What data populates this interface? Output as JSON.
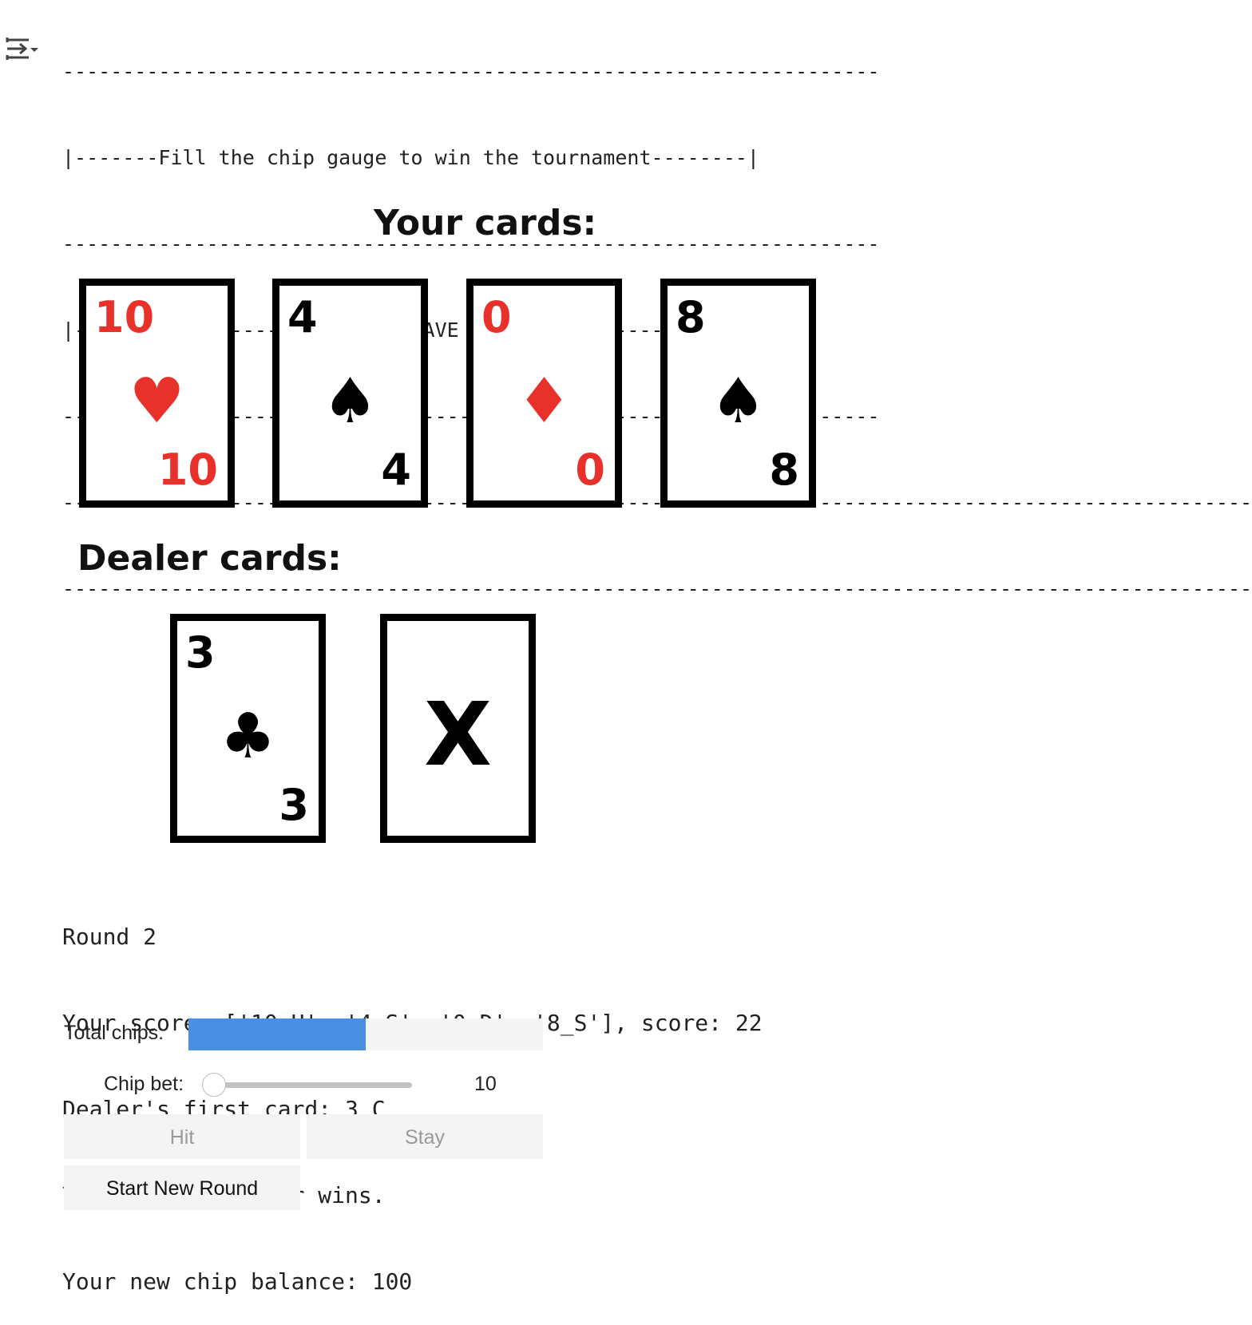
{
  "output_toggle": {
    "icon": "output-toggle-icon"
  },
  "banner": {
    "lines": [
      "--------------------------------------------------------------------",
      "|-------Fill the chip gauge to win the tournament--------|",
      "--------------------------------------------------------------------",
      "|-----------------GOOD LUCK. HAVE FUN------------------|",
      "--------------------------------------------------------------------",
      "----------------------------------------------------------------------------------------------------",
      "----------------------------------------------------------------------------------------------------"
    ]
  },
  "player": {
    "heading": "Your cards:",
    "cards": [
      {
        "rank": "10",
        "suit": "♥",
        "suit_name": "hearts",
        "color": "#e8312a"
      },
      {
        "rank": "4",
        "suit": "♠",
        "suit_name": "spades",
        "color": "#000000"
      },
      {
        "rank": "0",
        "suit": "♦",
        "suit_name": "diamonds",
        "color": "#e8312a"
      },
      {
        "rank": "8",
        "suit": "♠",
        "suit_name": "spades",
        "color": "#000000"
      }
    ]
  },
  "dealer": {
    "heading": "Dealer cards:",
    "cards": [
      {
        "rank": "3",
        "suit": "♣",
        "suit_name": "clubs",
        "color": "#000000"
      }
    ],
    "hidden_card": "X"
  },
  "log": {
    "round": "Round 2",
    "score": "Your score: ['10_H', '4_S', '0_D', '8_S'], score: 22",
    "dealer_first": "Dealer's first card: 3_C",
    "result": "You busted! Dealer wins.",
    "balance": "Your new chip balance: 100"
  },
  "gauge": {
    "label": "Total chips:",
    "fill_fraction": 0.5,
    "color": "#4a90e2"
  },
  "bet": {
    "label": "Chip bet:",
    "value": "10",
    "slider_fraction": 0
  },
  "buttons": {
    "hit": "Hit",
    "stay": "Stay",
    "new_round": "Start New Round"
  }
}
